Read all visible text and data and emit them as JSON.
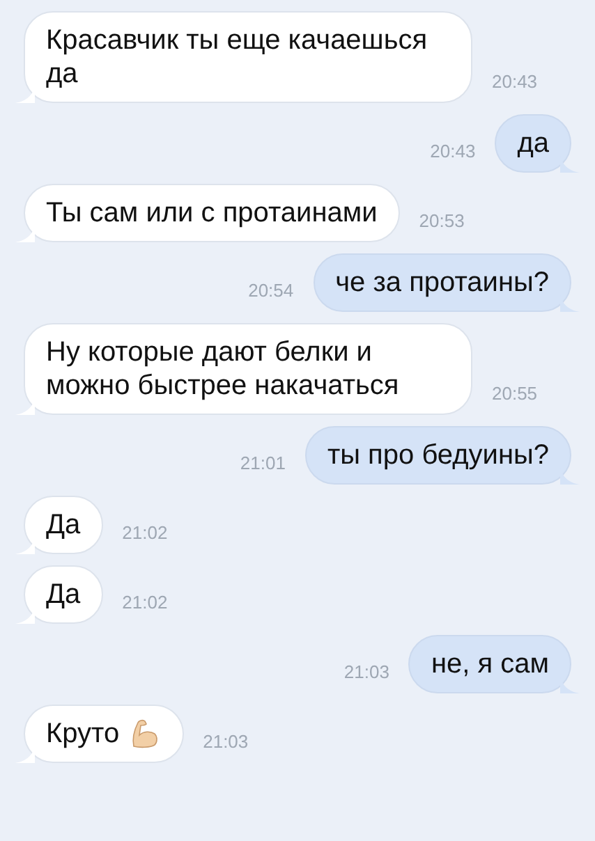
{
  "messages": [
    {
      "kind": "incoming",
      "text": "Красавчик ты еще качаешься да",
      "time": "20:43"
    },
    {
      "kind": "outgoing",
      "text": "да",
      "time": "20:43"
    },
    {
      "kind": "incoming",
      "text": "Ты сам или с протаинами",
      "time": "20:53"
    },
    {
      "kind": "outgoing",
      "text": "че за протаины?",
      "time": "20:54"
    },
    {
      "kind": "incoming",
      "text": "Ну которые дают белки и можно быстрее накачаться",
      "time": "20:55"
    },
    {
      "kind": "outgoing",
      "text": "ты про бедуины?",
      "time": "21:01"
    },
    {
      "kind": "incoming",
      "text": "Да",
      "time": "21:02"
    },
    {
      "kind": "incoming",
      "text": "Да",
      "time": "21:02"
    },
    {
      "kind": "outgoing",
      "text": "не, я сам",
      "time": "21:03"
    },
    {
      "kind": "incoming",
      "text": "Круто",
      "time": "21:03",
      "has_icon": true
    }
  ]
}
